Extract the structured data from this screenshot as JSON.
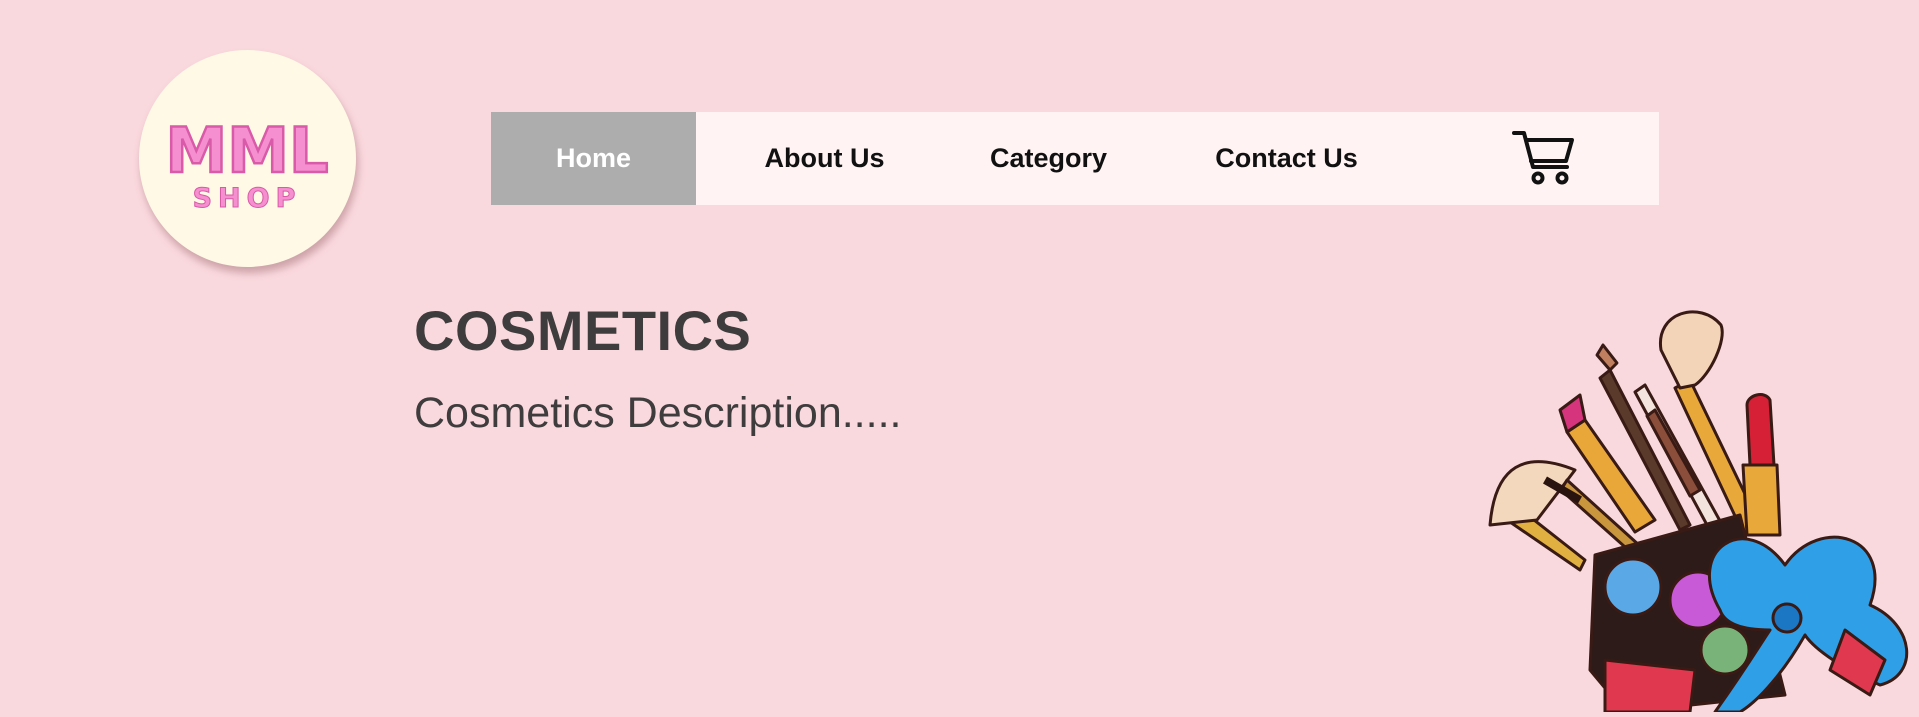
{
  "logo": {
    "line1": "MML",
    "line2": "SHOP"
  },
  "nav": {
    "items": [
      {
        "label": "Home",
        "active": true
      },
      {
        "label": "About Us",
        "active": false
      },
      {
        "label": "Category",
        "active": false
      },
      {
        "label": "Contact Us",
        "active": false
      }
    ],
    "cart_icon": "shopping-cart-icon"
  },
  "main": {
    "title": "COSMETICS",
    "description": "Cosmetics Description....."
  },
  "illustration": {
    "subject": "makeup-products-icon"
  },
  "colors": {
    "background": "#fad9de",
    "navbar": "#fff4f3",
    "nav_active": "#adadad",
    "logo_circle": "#fff9e6",
    "logo_pink": "#f582c8",
    "text_dark": "#3f3c3d"
  }
}
